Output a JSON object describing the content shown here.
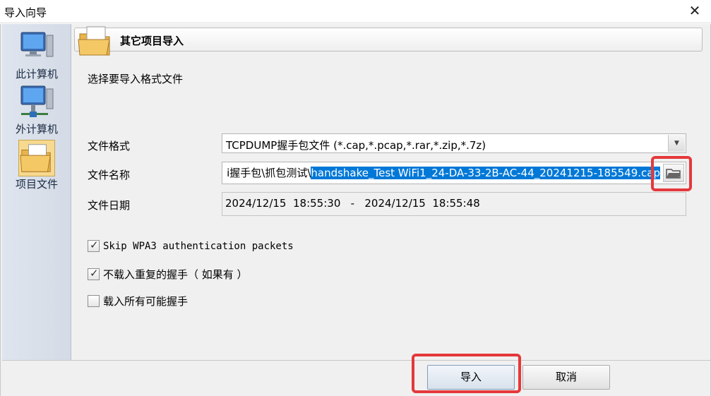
{
  "window": {
    "title": "导入向导",
    "close_label": "✕"
  },
  "sidebar": {
    "items": [
      {
        "label": "此计算机",
        "icon": "computer-icon"
      },
      {
        "label": "外计算机",
        "icon": "network-computer-icon"
      },
      {
        "label": "项目文件",
        "icon": "folder-icon",
        "selected": true
      }
    ]
  },
  "header": {
    "title": "其它项目导入"
  },
  "prompt": "选择要导入格式文件",
  "fields": {
    "format_label": "文件格式",
    "format_value": "TCPDUMP握手包文件 (*.cap,*.pcap,*.rar,*.zip,*.7z)",
    "name_label": "文件名称",
    "name_prefix": "i握手包\\抓包测试\\",
    "name_selected": "handshake_Test WiFi1_24-DA-33-2B-AC-44_20241215-185549.cap",
    "date_label": "文件日期",
    "date_value": "2024/12/15  18:55:30   -   2024/12/15  18:55:48"
  },
  "options": [
    {
      "label": "Skip WPA3 authentication packets",
      "checked": true
    },
    {
      "label": "不载入重复的握手（ 如果有 ）",
      "checked": true
    },
    {
      "label": "载入所有可能握手",
      "checked": false
    }
  ],
  "buttons": {
    "import": "导入",
    "cancel": "取消"
  },
  "colors": {
    "highlight": "#e5383b",
    "selection": "#0078d7"
  }
}
